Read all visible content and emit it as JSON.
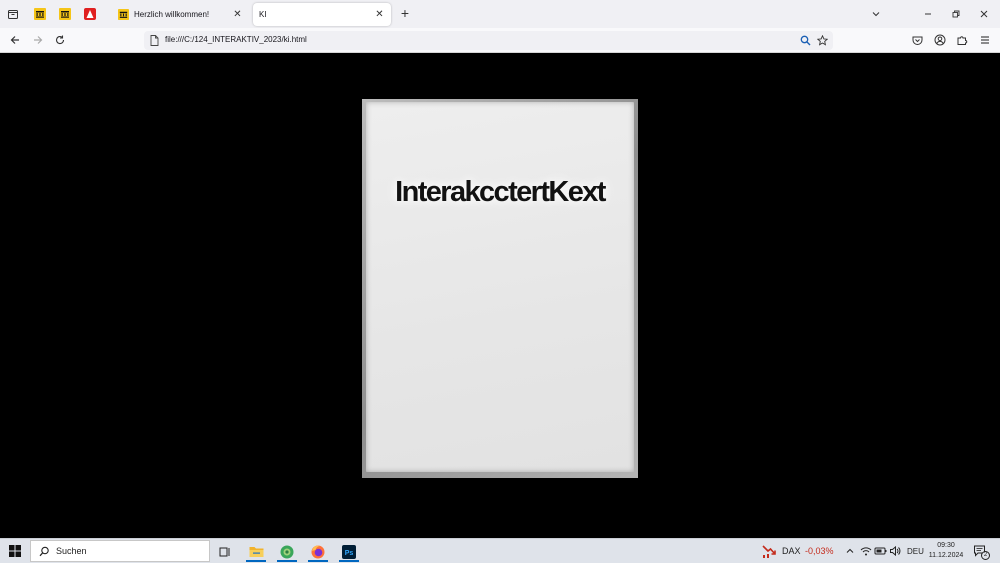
{
  "browser": {
    "tabs": [
      {
        "label": "Herzlich willkommen!",
        "active": false
      },
      {
        "label": "KI",
        "active": true
      }
    ],
    "url": "file:///C:/124_INTERAKTIV_2023/ki.html"
  },
  "page": {
    "title": "InterakcctertKext"
  },
  "taskbar": {
    "search_placeholder": "Suchen",
    "dax_label": "DAX",
    "dax_change": "-0,03%",
    "language": "DEU",
    "time": "09:30",
    "date": "11.12.2024",
    "notification_count": "2"
  },
  "colors": {
    "accent": "#0067c0",
    "dax_negative": "#c42b1c",
    "pinned_yellow": "#f5c518",
    "pinned_red": "#e02020"
  }
}
